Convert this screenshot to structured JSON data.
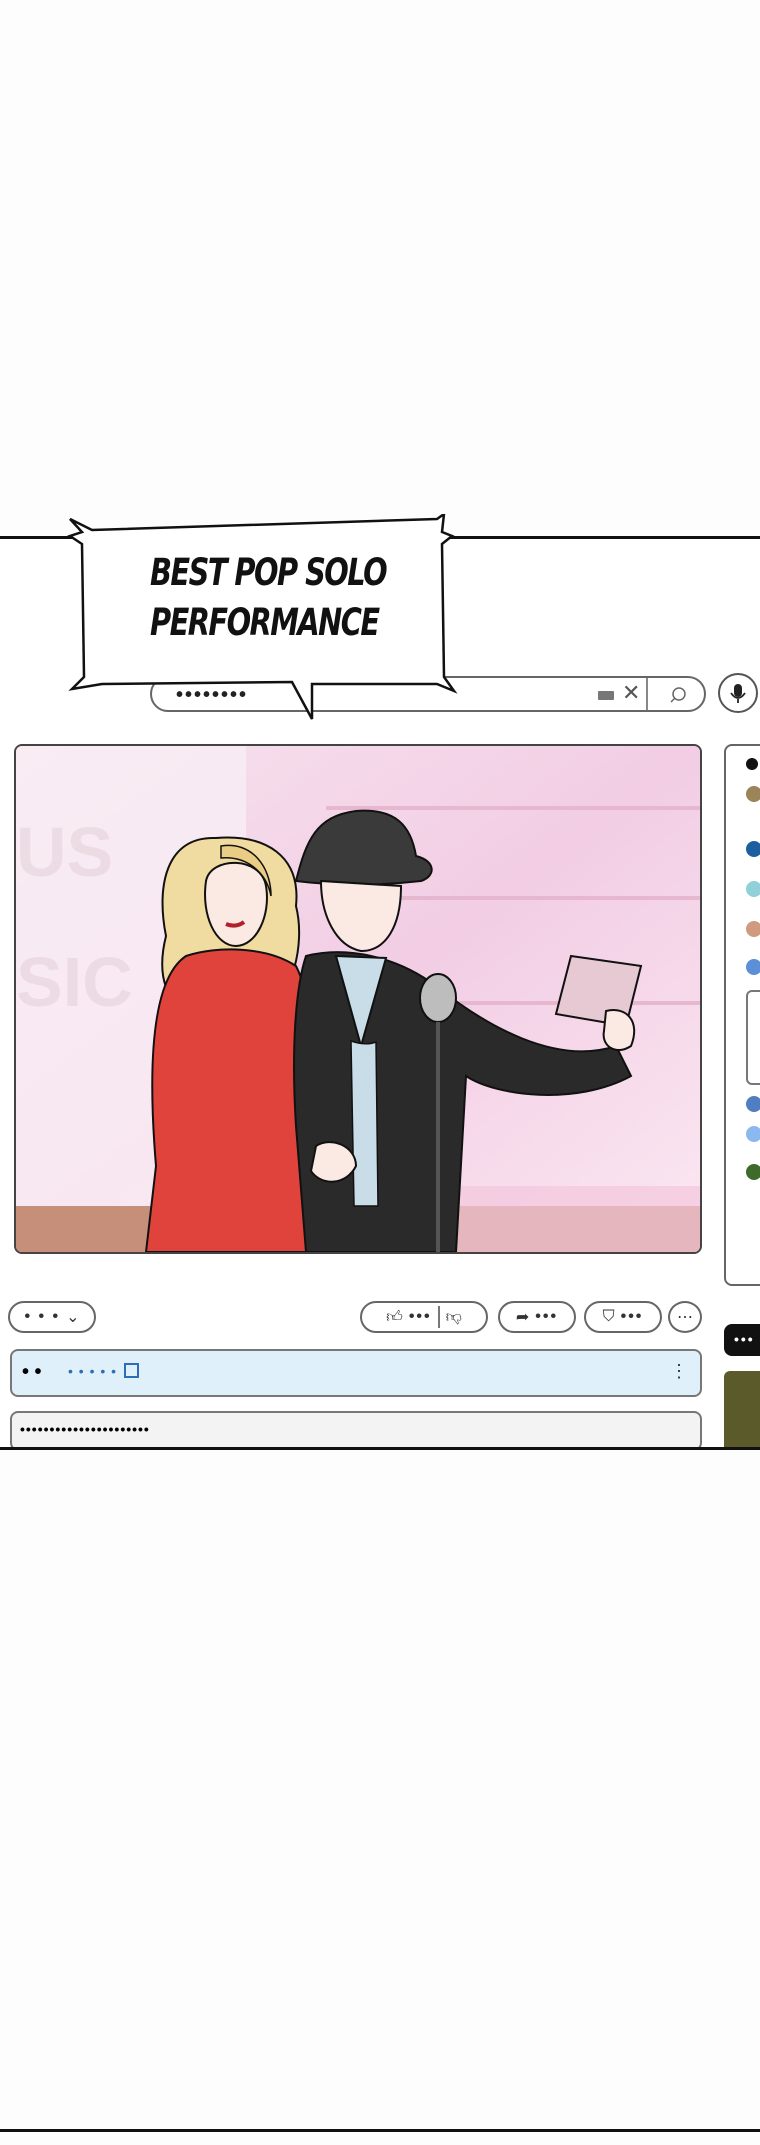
{
  "bubble": {
    "line1": "BEST POP SOLO",
    "line2": "PERFORMANCE"
  },
  "search": {
    "value": "••••••••"
  },
  "toolbar": {
    "channel_pill": "• • •",
    "like_count": "•••",
    "share_label": "•••",
    "save_label": "•••",
    "more": "⋯"
  },
  "description": {
    "meta_dots": "• •",
    "link_dots": "• • • • •",
    "more": "⋮"
  },
  "comment": {
    "placeholder": "••••••••••••••••••••••"
  },
  "sidebar": {
    "chip": "•••"
  },
  "colors": {
    "dress": "#e0433c",
    "suit": "#2a2a2a",
    "shirt": "#c9dde8",
    "backdrop": "#f4d6ea",
    "hair": "#f0dca0"
  }
}
